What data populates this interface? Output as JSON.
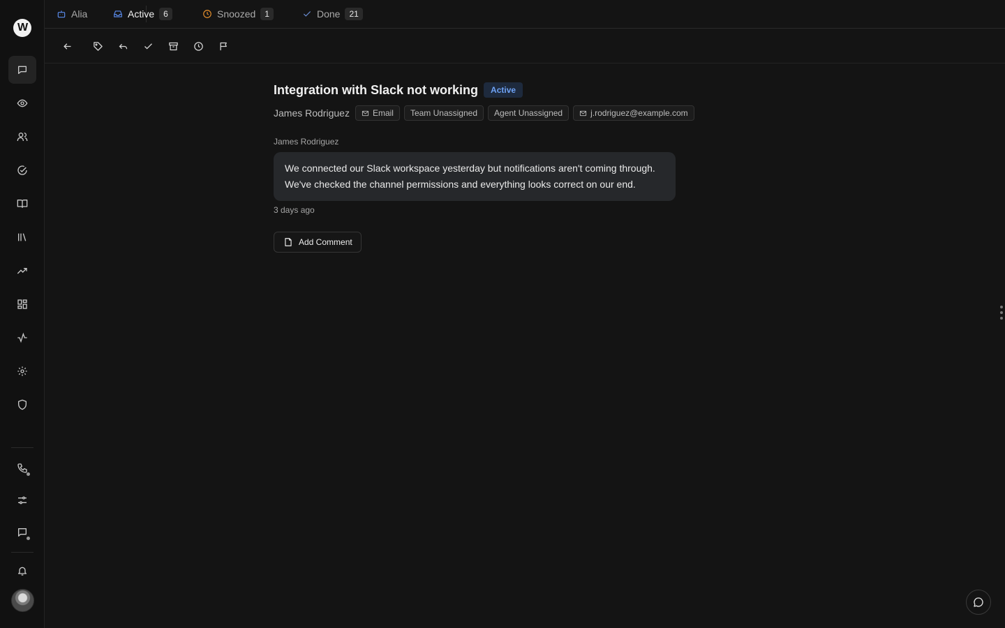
{
  "brand": {
    "logo_text": "W",
    "icon": "workspace-logo-icon"
  },
  "sidebar": {
    "items": [
      {
        "name": "conversations",
        "icon": "chat-bubble-icon",
        "active": true
      },
      {
        "name": "monitor",
        "icon": "eye-icon"
      },
      {
        "name": "customers",
        "icon": "users-icon"
      },
      {
        "name": "tasks",
        "icon": "check-circle-icon"
      },
      {
        "name": "knowledge-base",
        "icon": "book-icon"
      },
      {
        "name": "library",
        "icon": "library-icon"
      },
      {
        "name": "reports",
        "icon": "trending-up-icon"
      },
      {
        "name": "apps",
        "icon": "grid-icon"
      },
      {
        "name": "activity",
        "icon": "activity-icon"
      },
      {
        "name": "settings",
        "icon": "gear-icon"
      },
      {
        "name": "security",
        "icon": "shield-icon"
      }
    ],
    "bottom_items": [
      {
        "name": "phone",
        "icon": "phone-icon",
        "has_dot": true
      },
      {
        "name": "filters",
        "icon": "sliders-icon"
      },
      {
        "name": "messages",
        "icon": "message-square-icon",
        "has_dot": true
      },
      {
        "name": "notifications",
        "icon": "bell-icon"
      }
    ],
    "avatar": "user-avatar"
  },
  "tabs": [
    {
      "label": "Alia",
      "icon": "bot-icon",
      "color": "#5b8def"
    },
    {
      "label": "Active",
      "count": "6",
      "icon": "inbox-icon",
      "color": "#5b8def",
      "active": true
    },
    {
      "label": "Snoozed",
      "count": "1",
      "icon": "clock-icon",
      "color": "#e8912d"
    },
    {
      "label": "Done",
      "count": "21",
      "icon": "check-icon",
      "color": "#6b8fd6"
    }
  ],
  "toolbar": {
    "actions": [
      "back-arrow-icon",
      "tag-icon",
      "reply-icon",
      "check-icon",
      "archive-icon",
      "clock-icon",
      "flag-icon"
    ]
  },
  "ticket": {
    "title": "Integration with Slack not working",
    "status": "Active",
    "status_color": "#6ea2f5",
    "requester": "James Rodriguez",
    "chips": {
      "channel": "Email",
      "team": "Team Unassigned",
      "agent": "Agent Unassigned",
      "email": "j.rodriguez@example.com"
    },
    "message": {
      "author": "James Rodriguez",
      "body": "We connected our Slack workspace yesterday but notifications aren't coming through. We've checked the channel permissions and everything looks correct on our end.",
      "time": "3 days ago"
    },
    "add_comment_label": "Add Comment"
  }
}
